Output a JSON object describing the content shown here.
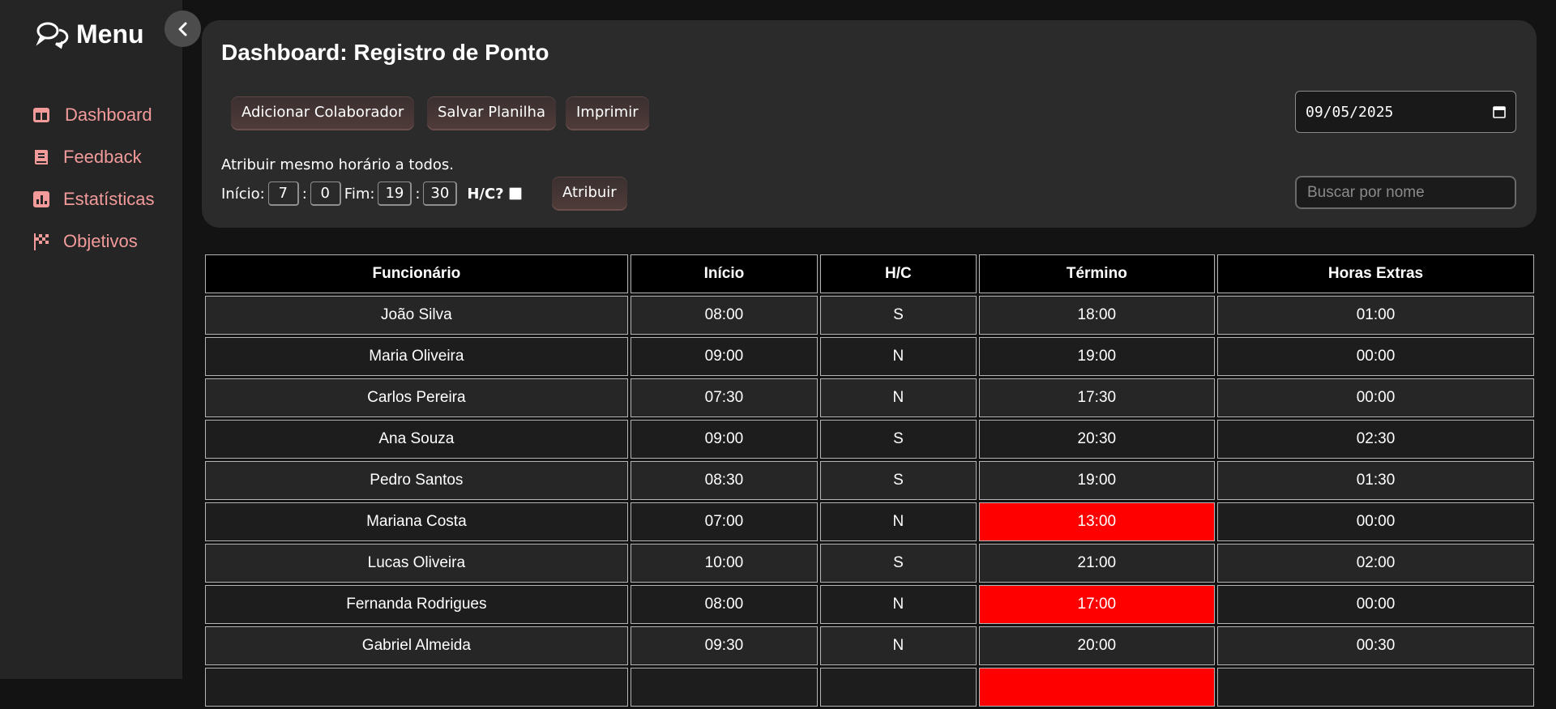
{
  "sidebar": {
    "title": "Menu",
    "items": [
      {
        "label": "Dashboard",
        "icon": "dashboard-icon"
      },
      {
        "label": "Feedback",
        "icon": "book-icon"
      },
      {
        "label": "Estatísticas",
        "icon": "bar-chart-icon"
      },
      {
        "label": "Objetivos",
        "icon": "checkered-flag-icon"
      }
    ],
    "accent": "#f39a9a"
  },
  "header": {
    "title": "Dashboard: Registro de Ponto",
    "buttons": {
      "add": "Adicionar Colaborador",
      "save": "Salvar Planilha",
      "print": "Imprimir"
    },
    "date_value": "09/05/2025"
  },
  "assign": {
    "label": "Atribuir mesmo horário a todos.",
    "start_label": "Início:",
    "start_hour": "7",
    "start_min": "0",
    "end_label": "Fim:",
    "end_hour": "19",
    "end_min": "30",
    "sep": ":",
    "hc_label": "H/C?",
    "button": "Atribuir"
  },
  "search": {
    "placeholder": "Buscar por nome"
  },
  "table": {
    "headers": [
      "Funcionário",
      "Início",
      "H/C",
      "Término",
      "Horas Extras"
    ],
    "rows": [
      [
        "João Silva",
        "08:00",
        "S",
        "18:00",
        "01:00"
      ],
      [
        "Maria Oliveira",
        "09:00",
        "N",
        "19:00",
        "00:00"
      ],
      [
        "Carlos Pereira",
        "07:30",
        "N",
        "17:30",
        "00:00"
      ],
      [
        "Ana Souza",
        "09:00",
        "S",
        "20:30",
        "02:30"
      ],
      [
        "Pedro Santos",
        "08:30",
        "S",
        "19:00",
        "01:30"
      ],
      [
        "Mariana Costa",
        "07:00",
        "N",
        "13:00",
        "00:00"
      ],
      [
        "Lucas Oliveira",
        "10:00",
        "S",
        "21:00",
        "02:00"
      ],
      [
        "Fernanda Rodrigues",
        "08:00",
        "N",
        "17:00",
        "00:00"
      ],
      [
        "Gabriel Almeida",
        "09:30",
        "N",
        "20:00",
        "00:30"
      ]
    ],
    "alert_color": "#ff0000"
  }
}
